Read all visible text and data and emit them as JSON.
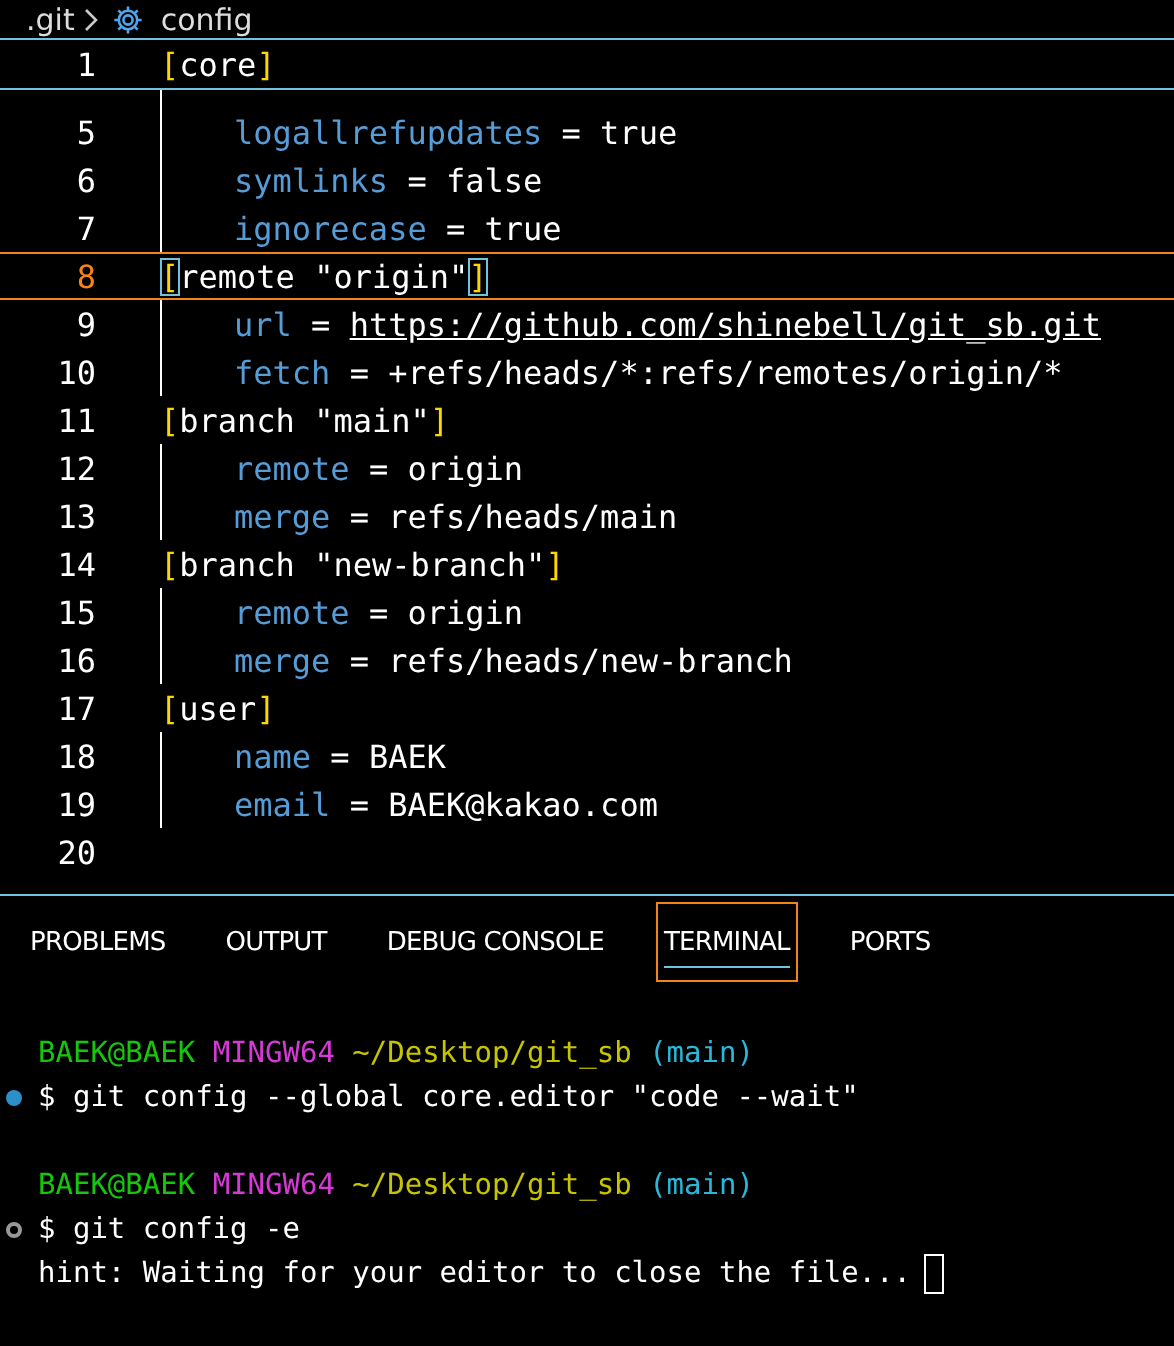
{
  "breadcrumb": {
    "folder": ".git",
    "file": "config"
  },
  "sticky_line": {
    "number": "1",
    "kind": "section",
    "open": "[",
    "name": "core",
    "close": "]"
  },
  "lines": [
    {
      "number": "5",
      "kind": "entry",
      "key": "logallrefupdates",
      "operator": "=",
      "value": "true",
      "link": false,
      "current": false
    },
    {
      "number": "6",
      "kind": "entry",
      "key": "symlinks",
      "operator": "=",
      "value": "false",
      "link": false,
      "current": false
    },
    {
      "number": "7",
      "kind": "entry",
      "key": "ignorecase",
      "operator": "=",
      "value": "true",
      "link": false,
      "current": false
    },
    {
      "number": "8",
      "kind": "section",
      "open": "[",
      "name": "remote \"origin\"",
      "close": "]",
      "current": true
    },
    {
      "number": "9",
      "kind": "entry",
      "key": "url",
      "operator": "=",
      "value": "https://github.com/shinebell/git_sb.git",
      "link": true,
      "current": false
    },
    {
      "number": "10",
      "kind": "entry",
      "key": "fetch",
      "operator": "=",
      "value": "+refs/heads/*:refs/remotes/origin/*",
      "link": false,
      "current": false
    },
    {
      "number": "11",
      "kind": "section",
      "open": "[",
      "name": "branch \"main\"",
      "close": "]",
      "current": false
    },
    {
      "number": "12",
      "kind": "entry",
      "key": "remote",
      "operator": "=",
      "value": "origin",
      "link": false,
      "current": false
    },
    {
      "number": "13",
      "kind": "entry",
      "key": "merge",
      "operator": "=",
      "value": "refs/heads/main",
      "link": false,
      "current": false
    },
    {
      "number": "14",
      "kind": "section",
      "open": "[",
      "name": "branch \"new-branch\"",
      "close": "]",
      "current": false
    },
    {
      "number": "15",
      "kind": "entry",
      "key": "remote",
      "operator": "=",
      "value": "origin",
      "link": false,
      "current": false
    },
    {
      "number": "16",
      "kind": "entry",
      "key": "merge",
      "operator": "=",
      "value": "refs/heads/new-branch",
      "link": false,
      "current": false
    },
    {
      "number": "17",
      "kind": "section",
      "open": "[",
      "name": "user",
      "close": "]",
      "current": false
    },
    {
      "number": "18",
      "kind": "entry",
      "key": "name",
      "operator": "=",
      "value": "BAEK",
      "link": false,
      "current": false
    },
    {
      "number": "19",
      "kind": "entry",
      "key": "email",
      "operator": "=",
      "value": "BAEK@kakao.com",
      "link": false,
      "current": false
    },
    {
      "number": "20",
      "kind": "blank",
      "current": false
    }
  ],
  "panel_tabs": [
    {
      "label": "PROBLEMS",
      "selected": false
    },
    {
      "label": "OUTPUT",
      "selected": false
    },
    {
      "label": "DEBUG CONSOLE",
      "selected": false
    },
    {
      "label": "TERMINAL",
      "selected": true
    },
    {
      "label": "PORTS",
      "selected": false
    }
  ],
  "terminal": [
    {
      "kind": "prompt",
      "user": "BAEK@BAEK",
      "system": "MINGW64",
      "path": "~/Desktop/git_sb",
      "branch": "(main)"
    },
    {
      "kind": "command",
      "running": false,
      "text": "$ git config --global core.editor \"code --wait\""
    },
    {
      "kind": "blank"
    },
    {
      "kind": "prompt",
      "user": "BAEK@BAEK",
      "system": "MINGW64",
      "path": "~/Desktop/git_sb",
      "branch": "(main)"
    },
    {
      "kind": "command",
      "running": true,
      "text": "$ git config -e"
    },
    {
      "kind": "output",
      "text": "hint: Waiting for your editor to close the file...",
      "cursor": true
    }
  ]
}
